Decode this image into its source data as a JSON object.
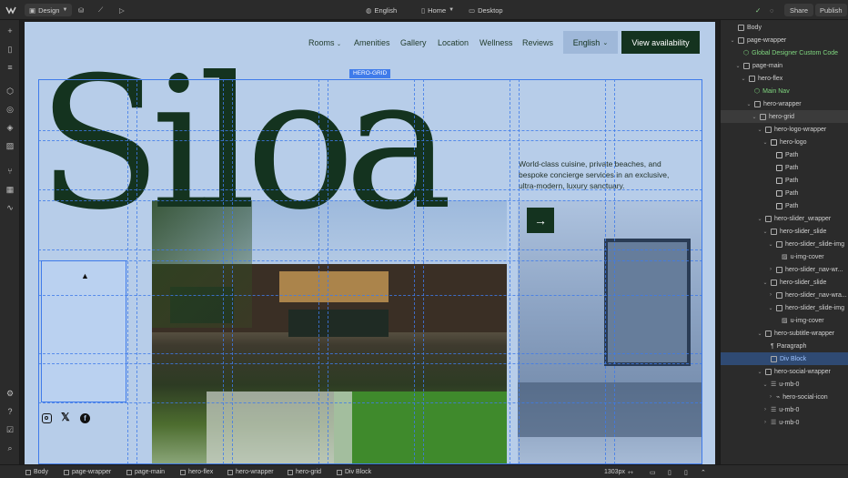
{
  "topbar": {
    "mode_label": "Design",
    "locale_label": "English",
    "page_label": "Home",
    "breakpoint_label": "Desktop",
    "share_label": "Share",
    "publish_label": "Publish"
  },
  "site": {
    "logo_text": "Siloa",
    "nav_items": [
      "Rooms",
      "Amenities",
      "Gallery",
      "Location",
      "Wellness",
      "Reviews"
    ],
    "language_label": "English",
    "cta_label": "View availability",
    "selection_tag": "HERO-GRID",
    "tagline": "World-class cuisine, private beaches, and bespoke concierge services in an exclusive, ultra-modern, luxury sanctuary.",
    "arrow_glyph": "→",
    "social_icons": [
      "instagram-icon",
      "x-icon",
      "facebook-icon"
    ]
  },
  "navigator": {
    "items": [
      {
        "label": "Body"
      },
      {
        "label": "page-wrapper"
      },
      {
        "label": "Global Designer Custom Code"
      },
      {
        "label": "page-main"
      },
      {
        "label": "hero-flex"
      },
      {
        "label": "Main Nav"
      },
      {
        "label": "hero-wrapper"
      },
      {
        "label": "hero-grid"
      },
      {
        "label": "hero-logo-wrapper"
      },
      {
        "label": "hero-logo"
      },
      {
        "label": "Path"
      },
      {
        "label": "Path"
      },
      {
        "label": "Path"
      },
      {
        "label": "Path"
      },
      {
        "label": "Path"
      },
      {
        "label": "hero-slider_wrapper"
      },
      {
        "label": "hero-slider_slide"
      },
      {
        "label": "hero-slider_slide-img"
      },
      {
        "label": "u-img-cover"
      },
      {
        "label": "hero-slider_nav-wr..."
      },
      {
        "label": "hero-slider_slide"
      },
      {
        "label": "hero-slider_nav-wra..."
      },
      {
        "label": "hero-slider_slide-img"
      },
      {
        "label": "u-img-cover"
      },
      {
        "label": "hero-subtitle-wrapper"
      },
      {
        "label": "Paragraph"
      },
      {
        "label": "Div Block"
      },
      {
        "label": "hero-social-wrapper"
      },
      {
        "label": "u-mb-0"
      },
      {
        "label": "hero-social-icon"
      },
      {
        "label": "u-mb-0"
      },
      {
        "label": "u-mb-0"
      }
    ]
  },
  "breadcrumbs": [
    "Body",
    "page-wrapper",
    "page-main",
    "hero-flex",
    "hero-wrapper",
    "hero-grid",
    "Div Block"
  ],
  "statusbar": {
    "width_label": "1303px"
  },
  "colors": {
    "canvas_bg": "#b7cde9",
    "brand_green": "#14331f",
    "selection_blue": "#3f7bea",
    "highlight_row": "#2f4a73"
  }
}
